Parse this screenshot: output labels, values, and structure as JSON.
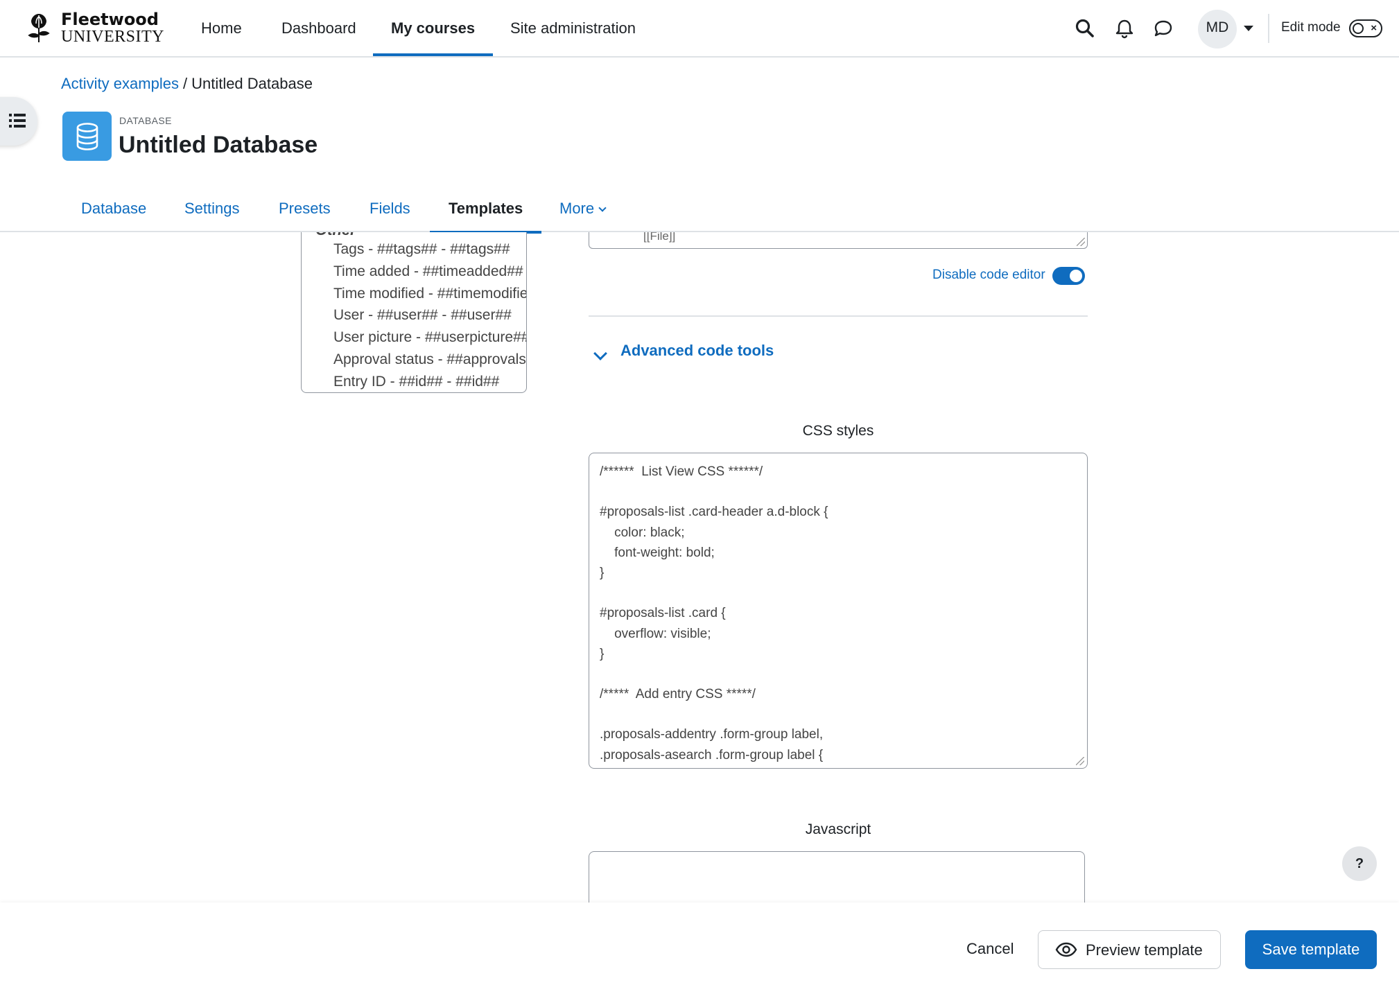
{
  "brand": {
    "line1": "Fleetwood",
    "line2": "UNIVERSITY"
  },
  "navbar": {
    "links": [
      {
        "label": "Home"
      },
      {
        "label": "Dashboard"
      },
      {
        "label": "My courses",
        "active": true
      },
      {
        "label": "Site administration"
      }
    ],
    "icons": [
      "search-icon",
      "bell-icon",
      "message-icon"
    ],
    "avatar_initials": "MD",
    "edit_mode_label": "Edit mode"
  },
  "breadcrumb": {
    "parent": "Activity examples",
    "separator": "/",
    "current": "Untitled Database"
  },
  "header": {
    "module_label": "DATABASE",
    "title": "Untitled Database"
  },
  "tabs": [
    {
      "label": "Database"
    },
    {
      "label": "Settings"
    },
    {
      "label": "Presets"
    },
    {
      "label": "Fields"
    },
    {
      "label": "Templates",
      "active": true
    },
    {
      "label": "More"
    }
  ],
  "tag_list": {
    "group": "Other",
    "items": [
      "Tags - ##tags## - ##tags##",
      "Time added - ##timeadded##",
      "Time modified - ##timemodified##",
      "User - ##user## - ##user##",
      "User picture - ##userpicture##",
      "Approval status - ##approvalstatus##",
      "Entry ID - ##id## - ##id##"
    ]
  },
  "top_code_snippet": "[[File]]",
  "code_editor": {
    "disable_label": "Disable code editor",
    "enabled": true
  },
  "advanced": {
    "label": "Advanced code tools"
  },
  "css_field": {
    "label": "CSS styles",
    "lines": [
      "/******  List View CSS ******/",
      "",
      "#proposals-list .card-header a.d-block {",
      "    color: black;",
      "    font-weight: bold;",
      "}",
      "",
      "#proposals-list .card {",
      "    overflow: visible;",
      "}",
      "",
      "/*****  Add entry CSS *****/",
      "",
      ".proposals-addentry .form-group label,",
      ".proposals-asearch .form-group label {"
    ]
  },
  "js_field": {
    "label": "Javascript",
    "value": ""
  },
  "footer": {
    "cancel": "Cancel",
    "preview": "Preview template",
    "save": "Save template"
  },
  "help": "?",
  "colors": {
    "primary": "#0f6cbf",
    "activity_icon": "#399be2",
    "text": "#1d2125",
    "border": "#8f959e"
  }
}
